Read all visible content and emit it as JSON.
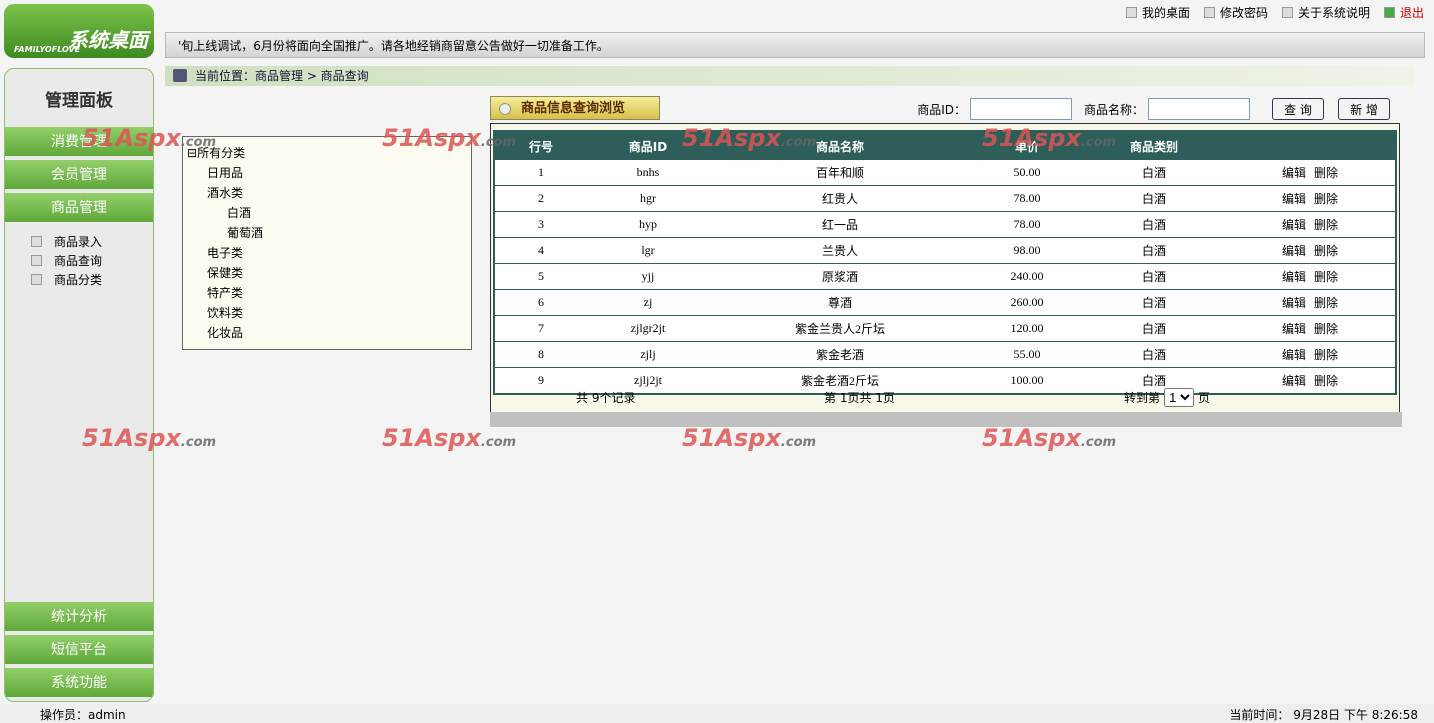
{
  "header": {
    "logo_text": "系统桌面",
    "logo_sub": "FAMILYOFLOVE",
    "nav": [
      "我的桌面",
      "修改密码",
      "关于系统说明",
      "退出"
    ],
    "notice": "'旬上线调试，6月份将面向全国推广。请各地经销商留意公告做好一切准备工作。"
  },
  "breadcrumb": "当前位置：商品管理 > 商品查询",
  "sidebar": {
    "title": "管理面板",
    "menus": [
      "消费管理",
      "会员管理",
      "商品管理"
    ],
    "submenu": [
      "商品录入",
      "商品查询",
      "商品分类"
    ],
    "bottom": [
      "统计分析",
      "短信平台",
      "系统功能"
    ]
  },
  "tree": {
    "root": "所有分类",
    "items": [
      {
        "label": "日用品",
        "level": 1
      },
      {
        "label": "酒水类",
        "level": 1
      },
      {
        "label": "白酒",
        "level": 2
      },
      {
        "label": "葡萄酒",
        "level": 2
      },
      {
        "label": "电子类",
        "level": 1
      },
      {
        "label": "保健类",
        "level": 1
      },
      {
        "label": "特产类",
        "level": 1
      },
      {
        "label": "饮料类",
        "level": 1
      },
      {
        "label": "化妆品",
        "level": 1
      }
    ]
  },
  "panel": {
    "title": "商品信息查询浏览",
    "id_label": "商品ID：",
    "name_label": "商品名称：",
    "id_value": "",
    "name_value": "",
    "search_btn": "查 询",
    "add_btn": "新 增"
  },
  "table": {
    "headers": [
      "行号",
      "商品ID",
      "商品名称",
      "单价",
      "商品类别",
      ""
    ],
    "edit": "编辑",
    "del": "删除",
    "rows": [
      [
        "1",
        "bnhs",
        "百年和顺",
        "50.00",
        "白酒"
      ],
      [
        "2",
        "hgr",
        "红贵人",
        "78.00",
        "白酒"
      ],
      [
        "3",
        "hyp",
        "红一品",
        "78.00",
        "白酒"
      ],
      [
        "4",
        "lgr",
        "兰贵人",
        "98.00",
        "白酒"
      ],
      [
        "5",
        "yjj",
        "原浆酒",
        "240.00",
        "白酒"
      ],
      [
        "6",
        "zj",
        "尊酒",
        "260.00",
        "白酒"
      ],
      [
        "7",
        "zjlgr2jt",
        "紫金兰贵人2斤坛",
        "120.00",
        "白酒"
      ],
      [
        "8",
        "zjlj",
        "紫金老酒",
        "55.00",
        "白酒"
      ],
      [
        "9",
        "zjlj2jt",
        "紫金老酒2斤坛",
        "100.00",
        "白酒"
      ]
    ]
  },
  "pager": {
    "total": "共 9个记录",
    "page": "第 1页共 1页",
    "goto": "转到第",
    "page_value": "1",
    "unit": "页"
  },
  "status": {
    "operator": "操作员：admin",
    "time": "当前时间： 9月28日 下午 8:26:58"
  },
  "watermark": {
    "main": "51Aspx",
    ".com": ".com"
  }
}
